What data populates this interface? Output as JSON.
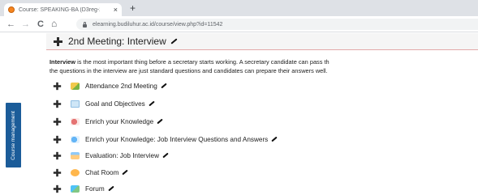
{
  "browser": {
    "tab_title": "Course: SPEAKING-BA (D3reg-20",
    "tab_close": "×",
    "new_tab": "+",
    "url": "elearning.budiluhur.ac.id/course/view.php?id=11542",
    "back": "←",
    "forward": "→",
    "reload": "C",
    "home": "⌂"
  },
  "section": {
    "title": "2nd Meeting: Interview",
    "summary_bold": "Interview",
    "summary_line1_rest": " is the most important thing before a secretary starts working. A secretary candidate can pass th",
    "summary_line2": "the questions in the interview are just standard questions and candidates can prepare their answers well."
  },
  "side_panel": {
    "label": "Course management"
  },
  "activities": [
    {
      "label": "Attendance 2nd Meeting",
      "icon": "attendance-icon"
    },
    {
      "label": "Goal and Objectives",
      "icon": "page-icon"
    },
    {
      "label": "Enrich your Knowledge",
      "icon": "url-icon"
    },
    {
      "label": "Enrich your Knowledge: Job Interview Questions and Answers",
      "icon": "url-icon"
    },
    {
      "label": "Evaluation: Job Interview",
      "icon": "quiz-icon"
    },
    {
      "label": "Chat Room",
      "icon": "chat-icon"
    },
    {
      "label": "Forum",
      "icon": "forum-icon"
    }
  ],
  "colors": {
    "side_tab": "#1b5c99",
    "header_bg": "#f5f5f5",
    "header_border": "#e2a9a9"
  }
}
